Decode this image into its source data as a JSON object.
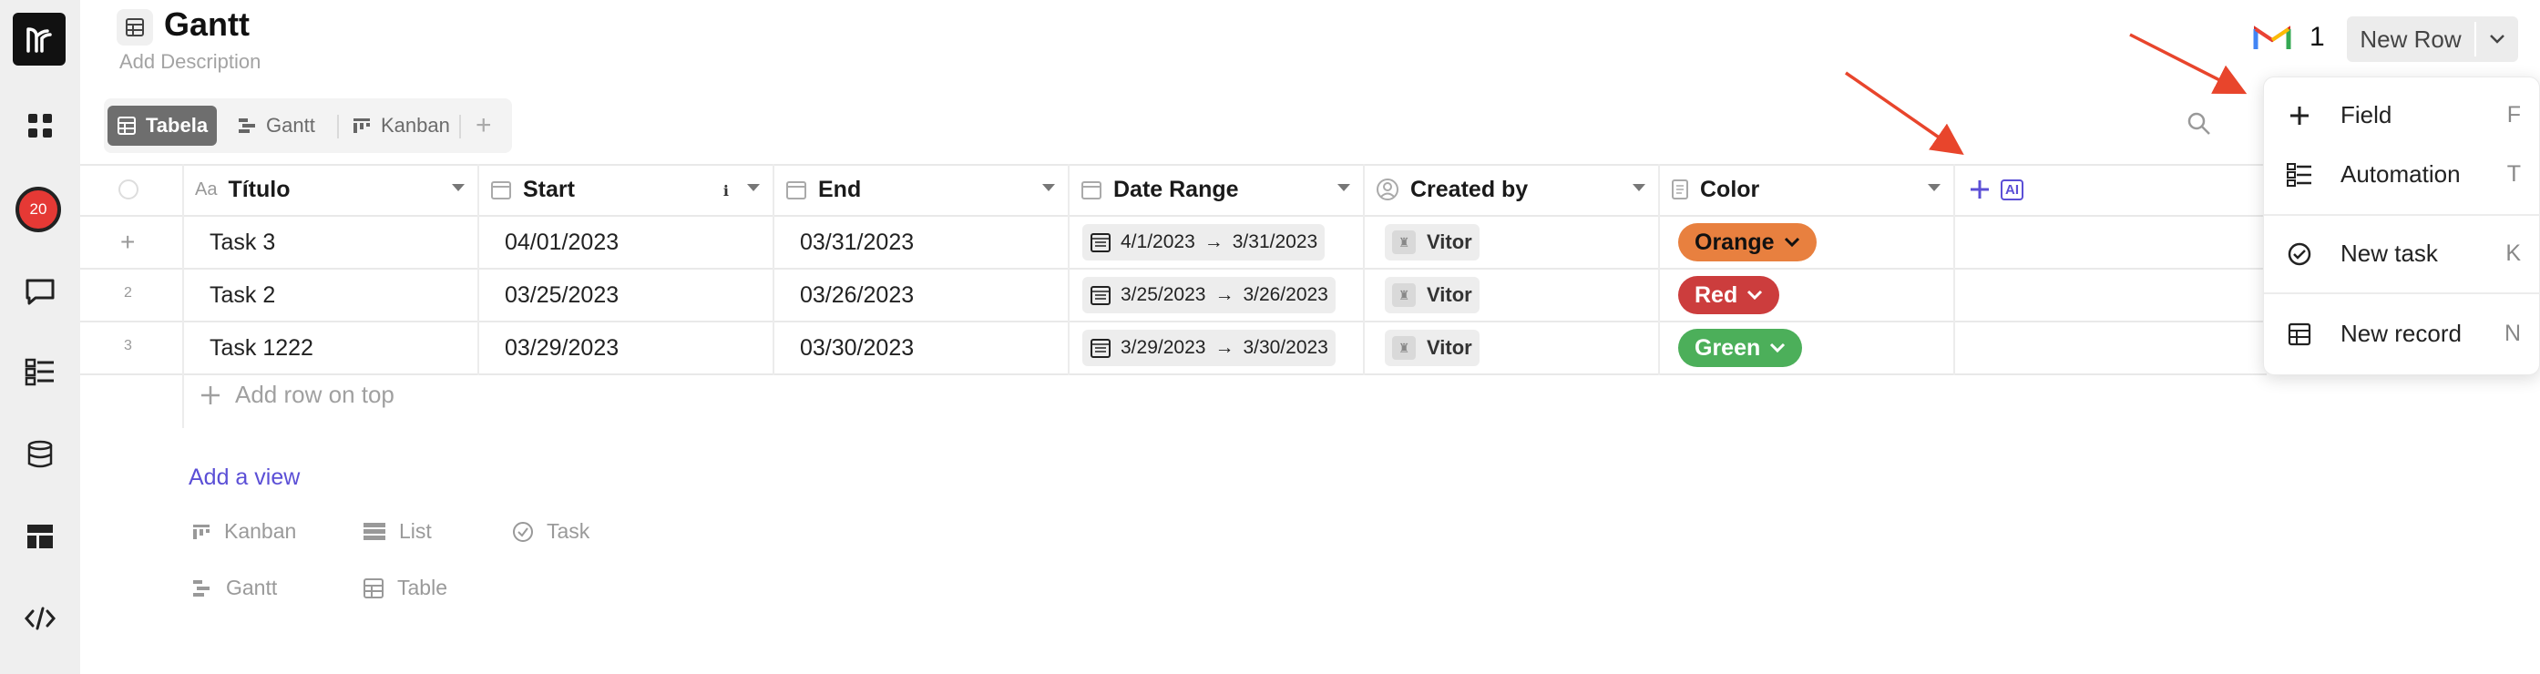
{
  "header": {
    "title": "Gantt",
    "description_placeholder": "Add Description",
    "notification_count": "1",
    "new_row_label": "New Row"
  },
  "sidebar": {
    "badge_count": "20"
  },
  "views": {
    "tabs": [
      {
        "label": "Tabela",
        "active": true
      },
      {
        "label": "Gantt",
        "active": false
      },
      {
        "label": "Kanban",
        "active": false
      }
    ]
  },
  "table": {
    "columns": [
      {
        "label": "Título",
        "icon": "text-icon"
      },
      {
        "label": "Start",
        "icon": "calendar-icon"
      },
      {
        "label": "End",
        "icon": "calendar-icon"
      },
      {
        "label": "Date Range",
        "icon": "calendar-icon"
      },
      {
        "label": "Created by",
        "icon": "person-icon"
      },
      {
        "label": "Color",
        "icon": "document-icon"
      }
    ],
    "rows": [
      {
        "num": "+",
        "title": "Task 3",
        "start": "04/01/2023",
        "end": "03/31/2023",
        "range_start": "4/1/2023",
        "range_end": "3/31/2023",
        "created_by": "Vitor",
        "color": "Orange"
      },
      {
        "num": "2",
        "title": "Task 2",
        "start": "03/25/2023",
        "end": "03/26/2023",
        "range_start": "3/25/2023",
        "range_end": "3/26/2023",
        "created_by": "Vitor",
        "color": "Red"
      },
      {
        "num": "3",
        "title": "Task 1222",
        "start": "03/29/2023",
        "end": "03/30/2023",
        "range_start": "3/29/2023",
        "range_end": "3/30/2023",
        "created_by": "Vitor",
        "color": "Green"
      }
    ],
    "add_row_label": "Add row on top",
    "ai_label": "AI"
  },
  "colors": {
    "Orange": "#e8803f",
    "Red": "#cc3d3d",
    "Green": "#4caf5a",
    "accent": "#5b4fd6",
    "annotation_arrow": "#e8452c"
  },
  "add_view": {
    "label": "Add a view",
    "options": [
      {
        "label": "Kanban",
        "icon": "kanban-icon"
      },
      {
        "label": "List",
        "icon": "list-icon"
      },
      {
        "label": "Task",
        "icon": "task-icon"
      },
      {
        "label": "Gantt",
        "icon": "gantt-icon"
      },
      {
        "label": "Table",
        "icon": "table-icon"
      }
    ]
  },
  "menu": {
    "items": [
      {
        "label": "Field",
        "key": "F",
        "icon": "plus-icon"
      },
      {
        "label": "Automation",
        "key": "T",
        "icon": "automation-icon"
      },
      {
        "label": "New task",
        "key": "K",
        "icon": "check-circle-icon"
      },
      {
        "label": "New record",
        "key": "N",
        "icon": "table-icon"
      }
    ]
  }
}
